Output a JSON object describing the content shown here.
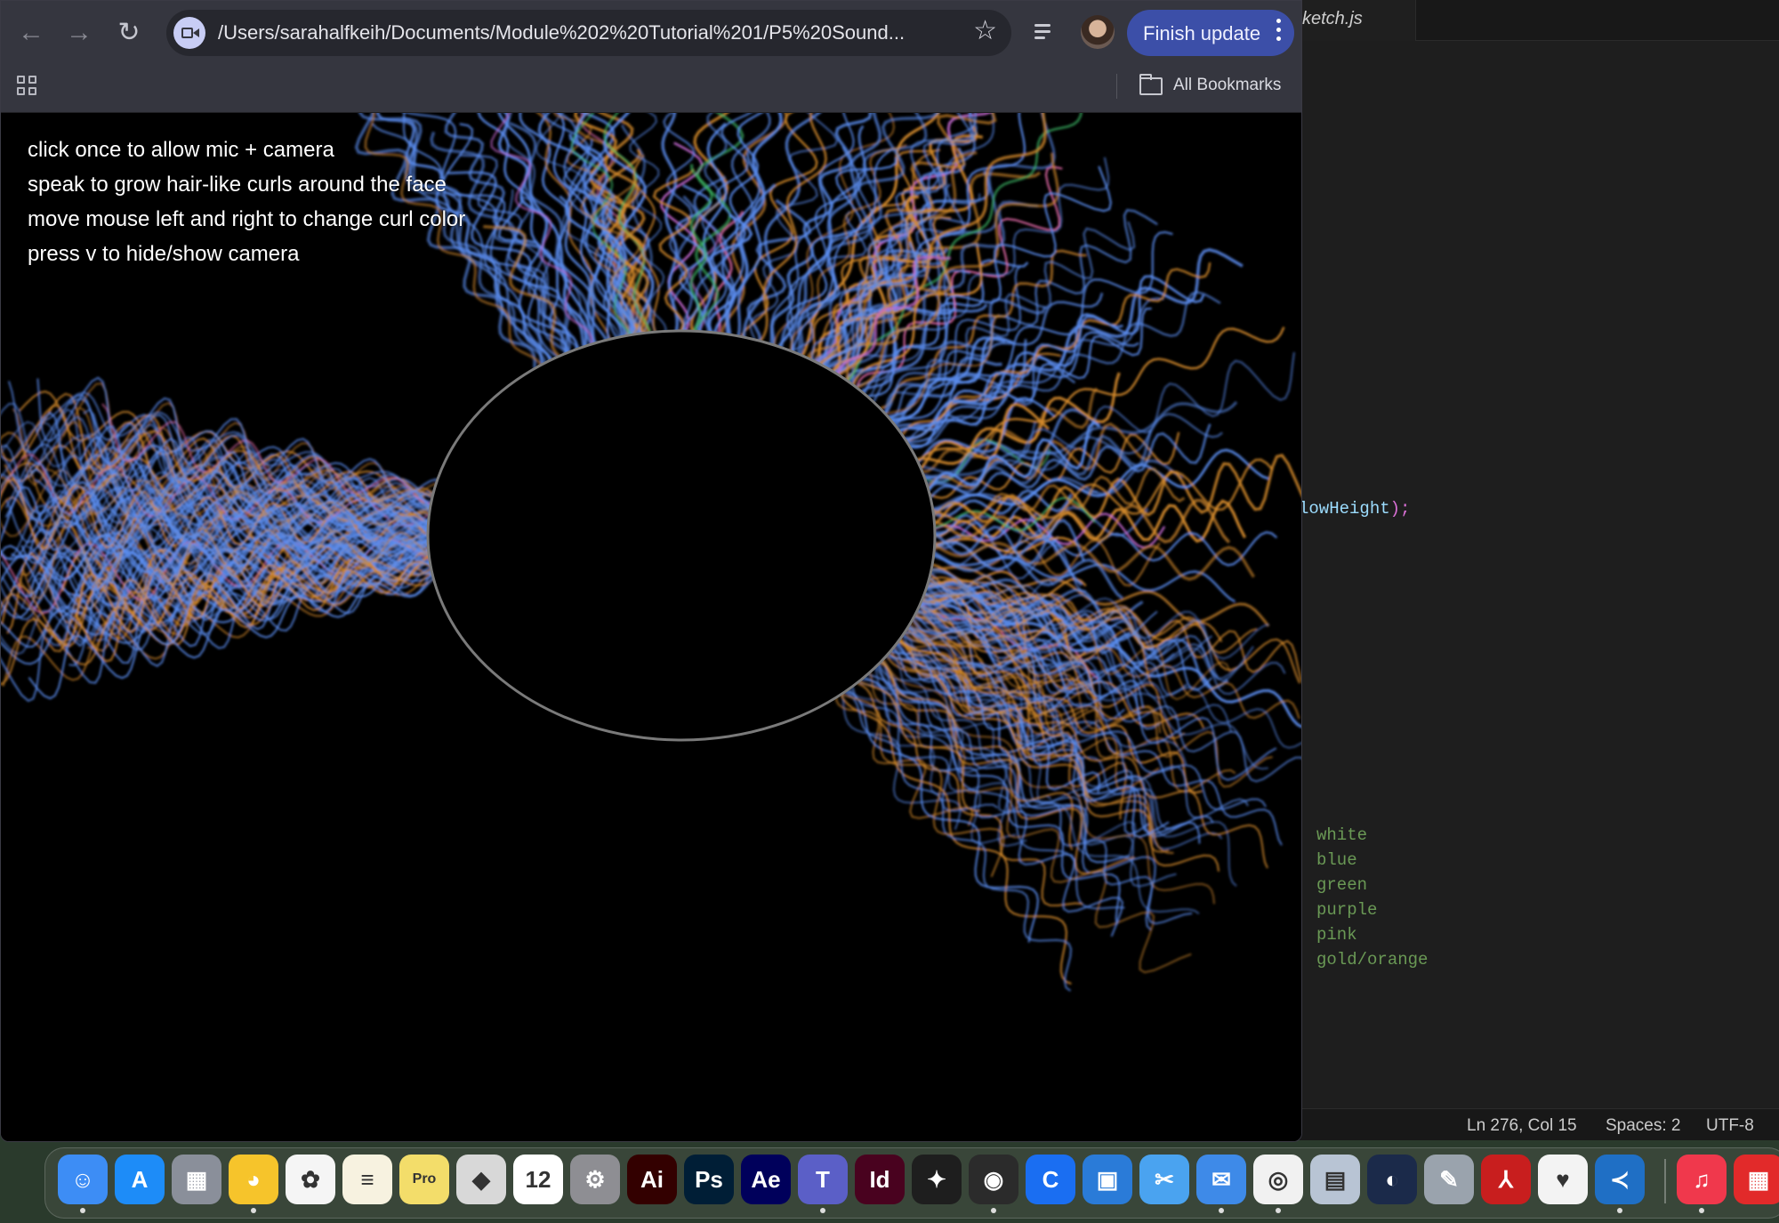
{
  "browser": {
    "url": "/Users/sarahalfkeih/Documents/Module%202%20Tutorial%201/P5%20Sound...",
    "finish_update_label": "Finish update",
    "bookmarks_label": "All Bookmarks",
    "icons": {
      "back": "back-arrow-icon",
      "forward": "forward-arrow-icon",
      "reload": "reload-icon",
      "site": "camera-icon",
      "star": "star-icon",
      "media": "media-controls-icon",
      "apps": "apps-grid-icon",
      "folder": "folder-icon"
    },
    "accent_color": "#3c4fa8"
  },
  "sketch": {
    "instructions": [
      "click once to allow mic + camera",
      "speak to grow hair-like curls around the face",
      "move mouse left and right to change curl color",
      "press v to hide/show camera"
    ],
    "curl_colors": [
      "#5b8def",
      "#d48a2c",
      "#3fbf6a",
      "#c96bd6",
      "#e26aa8"
    ]
  },
  "editor": {
    "tab_label": "ketch.js",
    "code_fragment": "lowHeight",
    "code_suffix": ");",
    "color_comments": [
      "white",
      "blue",
      "green",
      "purple",
      "pink",
      "gold/orange"
    ],
    "status": {
      "position": "Ln 276, Col 15",
      "spaces": "Spaces: 2",
      "encoding": "UTF-8"
    }
  },
  "dock": {
    "apps": [
      {
        "name": "Finder",
        "icon": "finder-icon",
        "color": "#3d8df5",
        "glyph": "☺"
      },
      {
        "name": "App Store",
        "icon": "app-store-icon",
        "color": "#1d8cf8",
        "glyph": "A"
      },
      {
        "name": "Launchpad",
        "icon": "launchpad-icon",
        "color": "#8a8f9a",
        "glyph": "▦"
      },
      {
        "name": "Cyberduck",
        "icon": "duck-icon",
        "color": "#f6c42b",
        "glyph": "◕"
      },
      {
        "name": "Photos",
        "icon": "photos-icon",
        "color": "#f5f5f5",
        "glyph": "✿"
      },
      {
        "name": "Notes",
        "icon": "notes-icon",
        "color": "#f7f2e0",
        "glyph": "≡"
      },
      {
        "name": "Stickies",
        "icon": "stickies-icon",
        "color": "#f3dd6a",
        "glyph": "Pro"
      },
      {
        "name": "Roblox",
        "icon": "roblox-icon",
        "color": "#d8d8d8",
        "glyph": "◆"
      },
      {
        "name": "Calendar",
        "icon": "calendar-icon",
        "color": "#ffffff",
        "glyph": "12"
      },
      {
        "name": "System Settings",
        "icon": "settings-icon",
        "color": "#8e8e93",
        "glyph": "⚙"
      },
      {
        "name": "Illustrator",
        "icon": "illustrator-icon",
        "color": "#330000",
        "glyph": "Ai"
      },
      {
        "name": "Photoshop",
        "icon": "photoshop-icon",
        "color": "#001e36",
        "glyph": "Ps"
      },
      {
        "name": "After Effects",
        "icon": "after-effects-icon",
        "color": "#00005b",
        "glyph": "Ae"
      },
      {
        "name": "Teams",
        "icon": "teams-icon",
        "color": "#5b5fc7",
        "glyph": "T"
      },
      {
        "name": "InDesign",
        "icon": "indesign-icon",
        "color": "#49021f",
        "glyph": "Id"
      },
      {
        "name": "Figma",
        "icon": "figma-icon",
        "color": "#1e1e1e",
        "glyph": "✦"
      },
      {
        "name": "Unity",
        "icon": "unity-icon",
        "color": "#2b2b2b",
        "glyph": "◉"
      },
      {
        "name": "Canva",
        "icon": "canva-icon",
        "color": "#1a6ef2",
        "glyph": "C"
      },
      {
        "name": "Frame",
        "icon": "frame-icon",
        "color": "#2a7bd8",
        "glyph": "▣"
      },
      {
        "name": "Screenshot",
        "icon": "scissors-icon",
        "color": "#4aa3f0",
        "glyph": "✂"
      },
      {
        "name": "Mail",
        "icon": "mail-icon",
        "color": "#3e8ae8",
        "glyph": "✉"
      },
      {
        "name": "Chrome",
        "icon": "chrome-icon",
        "color": "#f1f1f1",
        "glyph": "◎"
      },
      {
        "name": "Preview",
        "icon": "preview-icon",
        "color": "#b8c4d4",
        "glyph": "▤"
      },
      {
        "name": "Cinema 4D",
        "icon": "cinema4d-icon",
        "color": "#1b2a4a",
        "glyph": "◐"
      },
      {
        "name": "Pencil",
        "icon": "pencil-icon",
        "color": "#9aa3ad",
        "glyph": "✎"
      },
      {
        "name": "Acrobat",
        "icon": "acrobat-icon",
        "color": "#c81e1e",
        "glyph": "⅄"
      },
      {
        "name": "Bookmark",
        "icon": "bookmark-icon",
        "color": "#f3f3f3",
        "glyph": "♥"
      },
      {
        "name": "VS Code",
        "icon": "vscode-icon",
        "color": "#1f6fc5",
        "glyph": "≺"
      },
      {
        "name": "Music",
        "icon": "music-icon",
        "color": "#f0384c",
        "glyph": "♫"
      },
      {
        "name": "Photo Booth",
        "icon": "photo-booth-icon",
        "color": "#e22a2a",
        "glyph": "▦"
      }
    ]
  }
}
